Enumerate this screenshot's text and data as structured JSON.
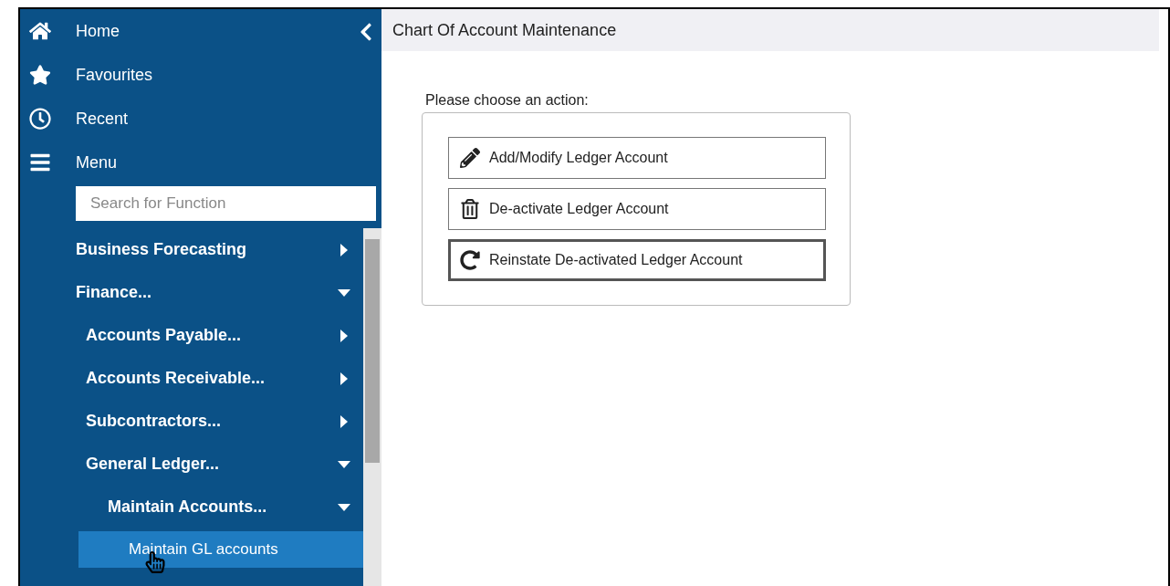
{
  "sidebar": {
    "nav": [
      {
        "kind": "home",
        "label": "Home"
      },
      {
        "kind": "star",
        "label": "Favourites"
      },
      {
        "kind": "clock",
        "label": "Recent"
      },
      {
        "kind": "bars",
        "label": "Menu"
      }
    ],
    "search": {
      "placeholder": "Search for Function"
    },
    "menu": [
      {
        "kind": "folder",
        "label": "Business Forecasting",
        "expanded": false,
        "selected": false
      },
      {
        "kind": "folder",
        "label": "Finance...",
        "expanded": true,
        "selected": false,
        "children": [
          {
            "kind": "folder",
            "label": "Accounts Payable...",
            "expanded": false,
            "selected": false
          },
          {
            "kind": "folder",
            "label": "Accounts Receivable...",
            "expanded": false,
            "selected": false
          },
          {
            "kind": "folder",
            "label": "Subcontractors...",
            "expanded": false,
            "selected": false
          },
          {
            "kind": "folder",
            "label": "General Ledger...",
            "expanded": true,
            "selected": false,
            "children": [
              {
                "kind": "folder",
                "label": "Maintain Accounts...",
                "expanded": true,
                "selected": false,
                "children": [
                  {
                    "kind": "function",
                    "label": "Maintain GL accounts",
                    "selected": true
                  }
                ]
              }
            ]
          }
        ]
      }
    ]
  },
  "header": {
    "title": "Chart Of Account Maintenance"
  },
  "actions": {
    "prompt": "Please choose an action:",
    "buttons": [
      {
        "kind": "pencil",
        "label": "Add/Modify Ledger Account",
        "focused": false
      },
      {
        "kind": "trash",
        "label": "De-activate Ledger Account",
        "focused": false
      },
      {
        "kind": "redo",
        "label": "Reinstate De-activated Ledger Account",
        "focused": true
      }
    ]
  }
}
